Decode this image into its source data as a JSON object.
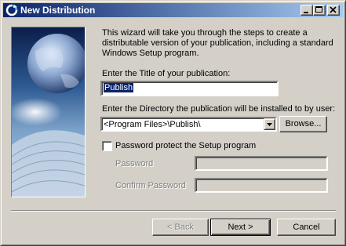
{
  "window": {
    "title": "New Distribution"
  },
  "intro_text": "This wizard will take you through the steps to create a distributable version of your publication, including a standard Windows Setup program.",
  "title_field": {
    "label": "Enter the Title of your publication:",
    "value": "Publish"
  },
  "directory_field": {
    "label": "Enter the Directory the publication will be installed to by user:",
    "value": "<Program Files>\\Publish\\",
    "browse_label": "Browse..."
  },
  "password_section": {
    "checkbox_label": "Password protect the Setup program",
    "checked": false,
    "password_label": "Password",
    "confirm_label": "Confirm Password"
  },
  "buttons": {
    "back": "< Back",
    "next": "Next >",
    "cancel": "Cancel"
  },
  "colors": {
    "titlebar_start": "#0a246a",
    "titlebar_end": "#a6caf0",
    "face": "#d4d0c8"
  },
  "icons": [
    "app-icon",
    "minimize-icon",
    "maximize-icon",
    "close-icon",
    "dropdown-arrow-icon"
  ]
}
